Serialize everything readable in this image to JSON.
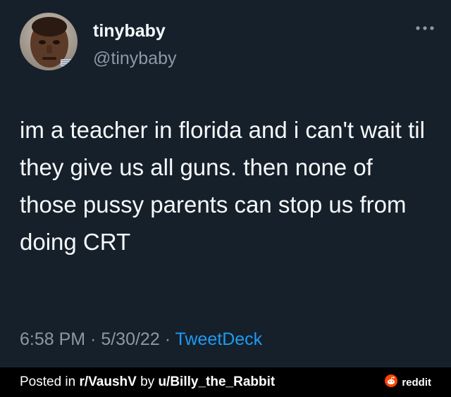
{
  "tweet": {
    "display_name": "tinybaby",
    "handle": "@tinybaby",
    "text": "im a teacher in florida and i can't wait til they give us all guns. then none of those pussy parents can stop us from doing CRT",
    "time": "6:58 PM",
    "sep1": " · ",
    "date": "5/30/22",
    "sep2": " · ",
    "source": "TweetDeck"
  },
  "footer": {
    "prefix": "Posted in ",
    "subreddit": "r/VaushV",
    "middle": " by ",
    "user": "u/Billy_the_Rabbit",
    "brand": "reddit"
  },
  "colors": {
    "background": "#15202b",
    "text": "#f7f9f9",
    "secondary": "#8b98a5",
    "link": "#1d9bf0",
    "reddit_orange": "#ff4500"
  },
  "icons": {
    "more": "more-horizontal-icon",
    "reddit": "reddit-logo-icon"
  }
}
